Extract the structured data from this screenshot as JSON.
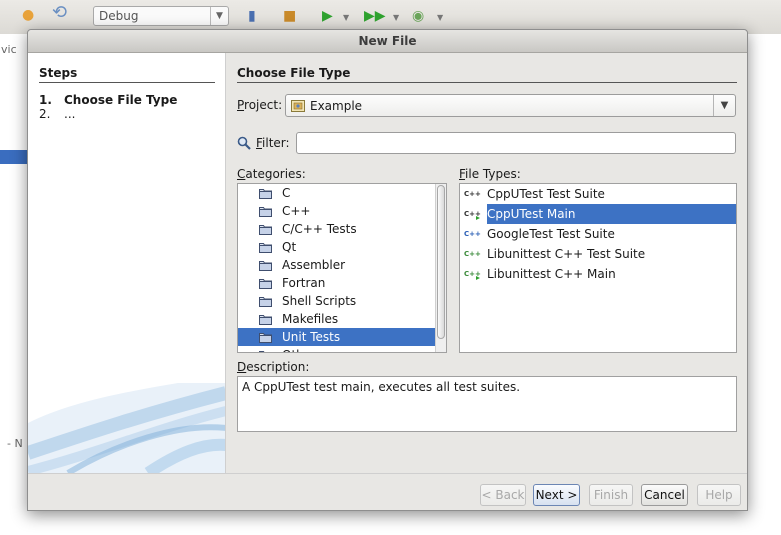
{
  "ide": {
    "config_combo": "Debug",
    "side_text_top": "vic",
    "side_text_bottom": "- N"
  },
  "dialog": {
    "title": "New File",
    "steps": {
      "header": "Steps",
      "items": [
        {
          "num": "1.",
          "label": "Choose File Type"
        },
        {
          "num": "2.",
          "label": "..."
        }
      ]
    },
    "main": {
      "header": "Choose File Type",
      "project_label_first": "P",
      "project_label_rest": "roject:",
      "project_value": "Example",
      "filter_label_first": "F",
      "filter_label_rest": "ilter:",
      "filter_value": "",
      "categories_label_first": "C",
      "categories_label_rest": "ategories:",
      "categories": [
        "C",
        "C++",
        "C/C++ Tests",
        "Qt",
        "Assembler",
        "Fortran",
        "Shell Scripts",
        "Makefiles",
        "Unit Tests",
        "Other"
      ],
      "selected_category": "Unit Tests",
      "file_types_label_first": "F",
      "file_types_label_rest": "ile Types:",
      "file_types": [
        {
          "label": "CppUTest Test Suite",
          "icon": "cpp-dark-icon"
        },
        {
          "label": "CppUTest Main",
          "icon": "cpp-main-icon"
        },
        {
          "label": "GoogleTest Test Suite",
          "icon": "cpp-blue-icon"
        },
        {
          "label": "Libunittest C++ Test Suite",
          "icon": "cpp-green-icon"
        },
        {
          "label": "Libunittest C++ Main",
          "icon": "cpp-green-main-icon"
        }
      ],
      "selected_file_type": "CppUTest Main",
      "description_label_first": "D",
      "description_label_rest": "escription:",
      "description": "A CppUTest test main, executes all test suites."
    },
    "buttons": {
      "back": "< Back",
      "next": "Next >",
      "finish": "Finish",
      "cancel": "Cancel",
      "help": "Help"
    },
    "colors": {
      "selection": "#3d72c4",
      "window_bg": "#e8e7e4"
    }
  }
}
